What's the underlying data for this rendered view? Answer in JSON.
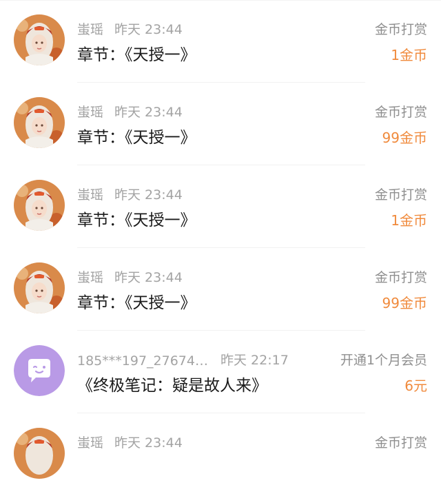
{
  "items": [
    {
      "name": "蚩瑶",
      "time": "昨天 23:44",
      "title": "章节：《天授一》",
      "type": "金币打赏",
      "amount": "1金币",
      "avatar": "girl-avatar-icon"
    },
    {
      "name": "蚩瑶",
      "time": "昨天 23:44",
      "title": "章节：《天授一》",
      "type": "金币打赏",
      "amount": "99金币",
      "avatar": "girl-avatar-icon"
    },
    {
      "name": "蚩瑶",
      "time": "昨天 23:44",
      "title": "章节：《天授一》",
      "type": "金币打赏",
      "amount": "1金币",
      "avatar": "girl-avatar-icon"
    },
    {
      "name": "蚩瑶",
      "time": "昨天 23:44",
      "title": "章节：《天授一》",
      "type": "金币打赏",
      "amount": "99金币",
      "avatar": "girl-avatar-icon"
    },
    {
      "name": "185***197_276741...",
      "time": "昨天 22:17",
      "title": "《终极笔记：疑是故人来》",
      "type": "开通1个月会员",
      "amount": "6元",
      "avatar": "chat-bubble-avatar-icon"
    },
    {
      "name": "蚩瑶",
      "time": "昨天 23:44",
      "title": "",
      "type": "金币打赏",
      "amount": "",
      "avatar": "girl-avatar-icon"
    }
  ],
  "colors": {
    "amount": "#f08a3c",
    "meta": "#a3a3a3",
    "title": "#1a1a1a",
    "type": "#8f8f8f",
    "chat_avatar_bg": "#b99ae6"
  }
}
